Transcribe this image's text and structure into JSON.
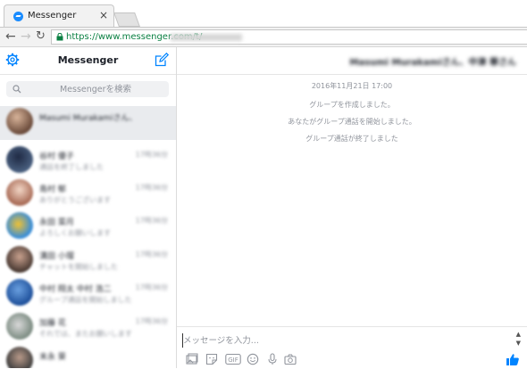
{
  "browser": {
    "tab_title": "Messenger",
    "tab_close": "×",
    "url_text": "https://www.messenger.com/t/"
  },
  "left_panel": {
    "title": "Messenger",
    "search_placeholder": "Messengerを検索",
    "conversations": [
      {
        "name": "Masumi Murakamiさん、",
        "snippet": "",
        "time": "",
        "active": true
      },
      {
        "name": "谷村 優子",
        "snippet": "通話を終了しました",
        "time": "17時36分"
      },
      {
        "name": "島村 郁",
        "snippet": "ありがとうございます",
        "time": "17時36分"
      },
      {
        "name": "永田 菜月",
        "snippet": "よろしくお願いします",
        "time": "17時36分"
      },
      {
        "name": "溝田 小瑠",
        "snippet": "チャットを開始しました",
        "time": "17時36分"
      },
      {
        "name": "中村 翔太 中村 浩二",
        "snippet": "グループ通話を開始しました",
        "time": "17時36分"
      },
      {
        "name": "加藤 花",
        "snippet": "それでは、またお願いします",
        "time": "17時36分"
      },
      {
        "name": "末永 葵",
        "snippet": "",
        "time": ""
      }
    ]
  },
  "thread": {
    "title": "Masumi Murakamiさん、中津 華さん",
    "system_messages": [
      "2016年11月21日 17:00",
      "グループを作成しました。",
      "あなたがグループ通話を開始しました。",
      "グループ通話が終了しました"
    ],
    "composer_placeholder": "メッセージを入力...",
    "gif_label": "GIF"
  },
  "colors": {
    "accent": "#0084ff",
    "secure_green": "#0b8043"
  }
}
